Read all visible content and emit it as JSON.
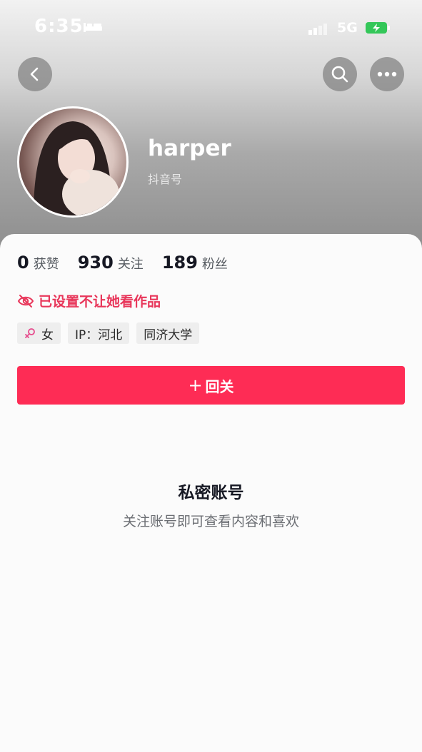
{
  "status_bar": {
    "time": "6:35",
    "network": "5G"
  },
  "profile": {
    "username": "harper",
    "account_id_label": "抖音号"
  },
  "stats": [
    {
      "value": "0",
      "label": "获赞"
    },
    {
      "value": "930",
      "label": "关注"
    },
    {
      "value": "189",
      "label": "粉丝"
    }
  ],
  "notice": "已设置不让她看作品",
  "tags": {
    "gender": "女",
    "ip": "IP：河北",
    "school": "同济大学"
  },
  "follow_button": {
    "icon": "+",
    "label": "回关"
  },
  "private": {
    "title": "私密账号",
    "description": "关注账号即可查看内容和喜欢"
  },
  "colors": {
    "accent": "#fe2c55",
    "notice": "#e8365a",
    "female": "#e64a8c"
  },
  "icons": [
    "bed-icon",
    "signal-icon",
    "battery-charging-icon",
    "back-arrow-icon",
    "search-icon",
    "more-icon",
    "eye-off-icon",
    "female-icon"
  ]
}
